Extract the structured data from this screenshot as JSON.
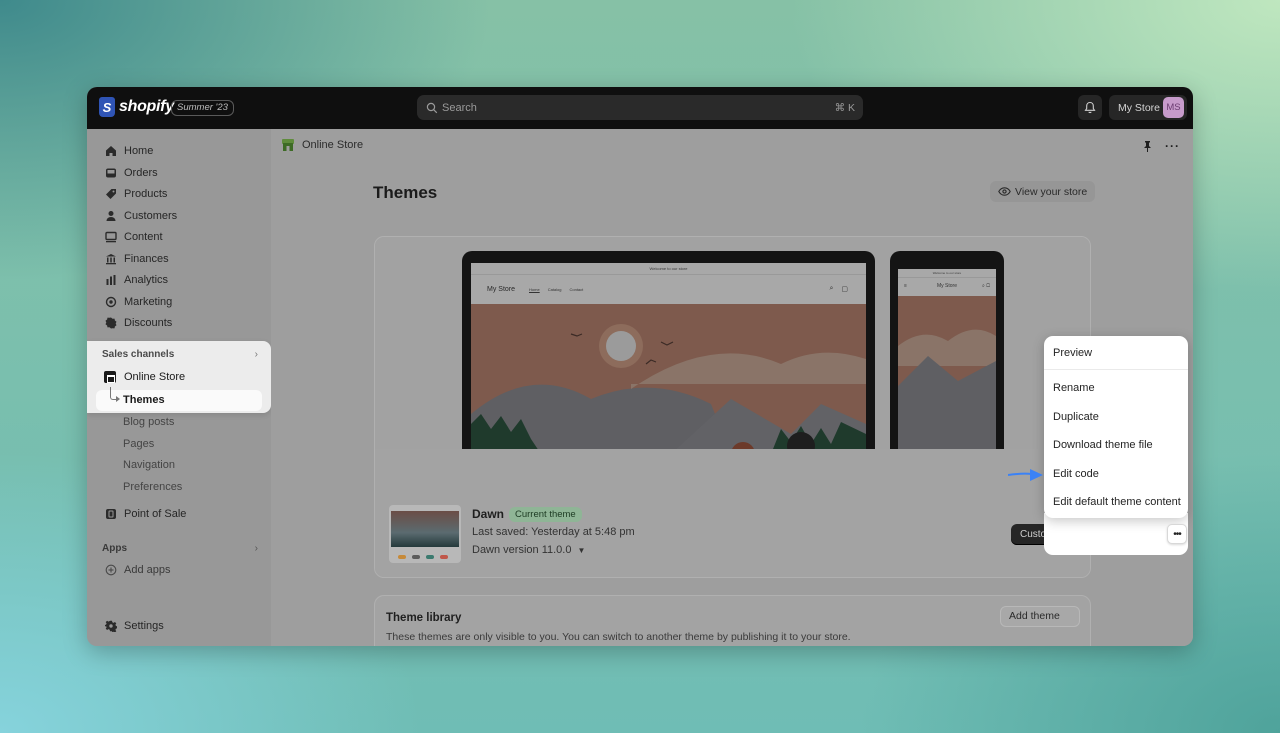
{
  "topbar": {
    "brand": "shopify",
    "brand_glyph": "S",
    "edition": "Summer '23",
    "search_placeholder": "Search",
    "search_shortcut": "⌘ K",
    "store_name": "My Store",
    "avatar_initials": "MS"
  },
  "sidebar": {
    "items": [
      {
        "label": "Home",
        "icon": "home-icon"
      },
      {
        "label": "Orders",
        "icon": "orders-icon"
      },
      {
        "label": "Products",
        "icon": "tag-icon"
      },
      {
        "label": "Customers",
        "icon": "person-icon"
      },
      {
        "label": "Content",
        "icon": "content-icon"
      },
      {
        "label": "Finances",
        "icon": "bank-icon"
      },
      {
        "label": "Analytics",
        "icon": "bar-chart-icon"
      },
      {
        "label": "Marketing",
        "icon": "target-icon"
      },
      {
        "label": "Discounts",
        "icon": "discount-icon"
      }
    ],
    "sales_channels_label": "Sales channels",
    "online_store_label": "Online Store",
    "online_store_sub": [
      {
        "label": "Themes",
        "active": true
      },
      {
        "label": "Blog posts"
      },
      {
        "label": "Pages"
      },
      {
        "label": "Navigation"
      },
      {
        "label": "Preferences"
      }
    ],
    "point_of_sale_label": "Point of Sale",
    "apps_label": "Apps",
    "add_apps_label": "Add apps",
    "settings_label": "Settings"
  },
  "main": {
    "breadcrumb": "Online Store",
    "page_title": "Themes",
    "view_store_label": "View your store",
    "preview": {
      "announcement": "Welcome to our store",
      "store_name": "My Store",
      "nav": [
        "Home",
        "Catalog",
        "Contact"
      ]
    },
    "current_theme": {
      "name": "Dawn",
      "badge": "Current theme",
      "last_saved": "Last saved: Yesterday at 5:48 pm",
      "version": "Dawn version 11.0.0",
      "customize_label": "Customize",
      "more_label": "•••"
    },
    "actions_menu": [
      {
        "label": "Preview"
      },
      {
        "label": "Rename"
      },
      {
        "label": "Duplicate"
      },
      {
        "label": "Download theme file"
      },
      {
        "label": "Edit code",
        "annotated": true
      },
      {
        "label": "Edit default theme content"
      }
    ],
    "theme_library": {
      "title": "Theme library",
      "description": "These themes are only visible to you. You can switch to another theme by publishing it to your store.",
      "add_label": "Add theme"
    }
  },
  "colors": {
    "topbar_bg": "#0f0f0f",
    "brand_blue": "#2f54b5",
    "avatar_bg": "#c79bcb",
    "badge_green": "#8fb596",
    "annotation_arrow": "#3b82f6"
  }
}
